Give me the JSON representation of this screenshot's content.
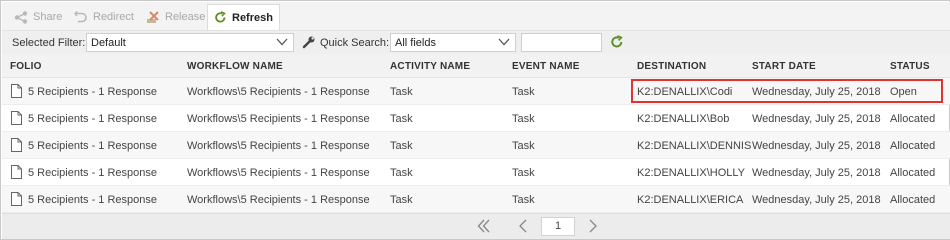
{
  "toolbar": {
    "share_label": "Share",
    "redirect_label": "Redirect",
    "release_label": "Release",
    "refresh_label": "Refresh"
  },
  "filters": {
    "selected_filter_label": "Selected Filter:",
    "selected_filter_value": "Default",
    "quick_search_label": "Quick Search:",
    "quick_search_field": "All fields",
    "quick_search_text": ""
  },
  "columns": [
    "FOLIO",
    "WORKFLOW NAME",
    "ACTIVITY NAME",
    "EVENT NAME",
    "DESTINATION",
    "START DATE",
    "STATUS"
  ],
  "rows": [
    {
      "folio": "5 Recipients - 1 Response",
      "workflow": "Workflows\\5 Recipients - 1 Response",
      "activity": "Task",
      "event": "Task",
      "destination": "K2:DENALLIX\\Codi",
      "start_date": "Wednesday, July 25, 2018",
      "status": "Open"
    },
    {
      "folio": "5 Recipients - 1 Response",
      "workflow": "Workflows\\5 Recipients - 1 Response",
      "activity": "Task",
      "event": "Task",
      "destination": "K2:DENALLIX\\Bob",
      "start_date": "Wednesday, July 25, 2018",
      "status": "Allocated"
    },
    {
      "folio": "5 Recipients - 1 Response",
      "workflow": "Workflows\\5 Recipients - 1 Response",
      "activity": "Task",
      "event": "Task",
      "destination": "K2:DENALLIX\\DENNIS",
      "start_date": "Wednesday, July 25, 2018",
      "status": "Allocated"
    },
    {
      "folio": "5 Recipients - 1 Response",
      "workflow": "Workflows\\5 Recipients - 1 Response",
      "activity": "Task",
      "event": "Task",
      "destination": "K2:DENALLIX\\HOLLY",
      "start_date": "Wednesday, July 25, 2018",
      "status": "Allocated"
    },
    {
      "folio": "5 Recipients - 1 Response",
      "workflow": "Workflows\\5 Recipients - 1 Response",
      "activity": "Task",
      "event": "Task",
      "destination": "K2:DENALLIX\\ERICA",
      "start_date": "Wednesday, July 25, 2018",
      "status": "Allocated"
    }
  ],
  "pager": {
    "current_page": "1"
  },
  "colors": {
    "highlight": "#e0322f",
    "refresh_icon": "#5f8f2a"
  }
}
